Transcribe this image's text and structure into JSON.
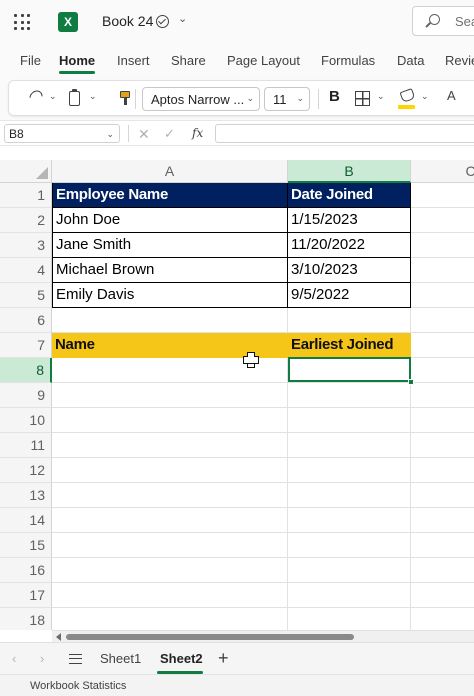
{
  "titlebar": {
    "app_icon_letter": "X",
    "doc_title": "Book 24",
    "search_placeholder": "Sea"
  },
  "menu_tabs": [
    "File",
    "Home",
    "Insert",
    "Share",
    "Page Layout",
    "Formulas",
    "Data",
    "Revie"
  ],
  "active_tab": "Home",
  "ribbon": {
    "font_name": "Aptos Narrow ...",
    "font_size": "11",
    "bold_label": "B",
    "font_color_label": "A"
  },
  "formula_bar": {
    "name_box": "B8",
    "cancel_glyph": "✕",
    "enter_glyph": "✓",
    "fx_label": "fx",
    "formula": ""
  },
  "grid": {
    "columns": [
      "A",
      "B",
      "C"
    ],
    "rows": [
      "1",
      "2",
      "3",
      "4",
      "5",
      "6",
      "7",
      "8",
      "9",
      "10",
      "11",
      "12",
      "13",
      "14",
      "15",
      "16",
      "17",
      "18"
    ],
    "selected_column": "B",
    "selected_row": "8",
    "table_header": [
      "Employee Name",
      "Date Joined"
    ],
    "table_rows": [
      [
        "John Doe",
        "1/15/2023"
      ],
      [
        "Jane Smith",
        "11/20/2022"
      ],
      [
        "Michael Brown",
        "3/10/2023"
      ],
      [
        "Emily Davis",
        "9/5/2022"
      ]
    ],
    "lookup_header": [
      "Name",
      "Earliest Joined"
    ],
    "lookup_values": [
      "",
      ""
    ]
  },
  "sheets": {
    "prev_glyph": "‹",
    "next_glyph": "›",
    "tabs": [
      "Sheet1",
      "Sheet2"
    ],
    "active": "Sheet2",
    "add_glyph": "+"
  },
  "status_bar": {
    "text": "Workbook Statistics"
  },
  "colors": {
    "accent": "#107c41",
    "table_header_bg": "#002060",
    "lookup_header_bg": "#f5c518",
    "selection_header_bg": "#caead6"
  }
}
